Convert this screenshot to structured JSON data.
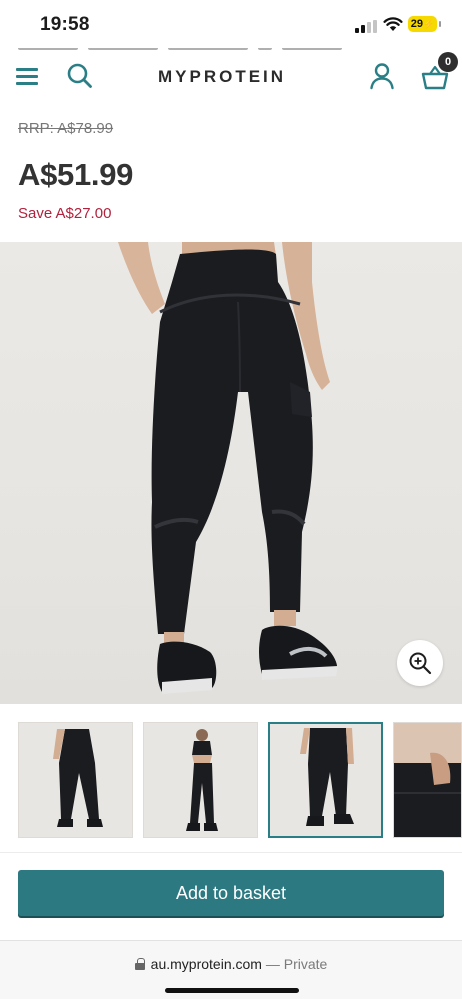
{
  "status_bar": {
    "time": "19:58",
    "battery": "29"
  },
  "header": {
    "brand": "MYPROTEIN",
    "basket_count": "0",
    "icons": {
      "menu": "hamburger-menu-icon",
      "search": "search-icon",
      "account": "account-icon",
      "basket": "basket-icon"
    },
    "accent_color": "#2a7f86"
  },
  "pricing": {
    "rrp": "RRP: A$78.99",
    "price": "A$51.99",
    "save": "Save A$27.00",
    "save_color": "#b0223e"
  },
  "gallery": {
    "zoom_icon": "zoom-in-icon",
    "thumbnails": [
      {
        "id": "thumb-1",
        "selected": false
      },
      {
        "id": "thumb-2",
        "selected": false
      },
      {
        "id": "thumb-3",
        "selected": true
      },
      {
        "id": "thumb-4",
        "selected": false
      }
    ]
  },
  "cta": {
    "add_to_basket": "Add to basket",
    "color": "#2d7982"
  },
  "browser": {
    "domain": "au.myprotein.com",
    "separator": " — ",
    "mode": "Private"
  }
}
